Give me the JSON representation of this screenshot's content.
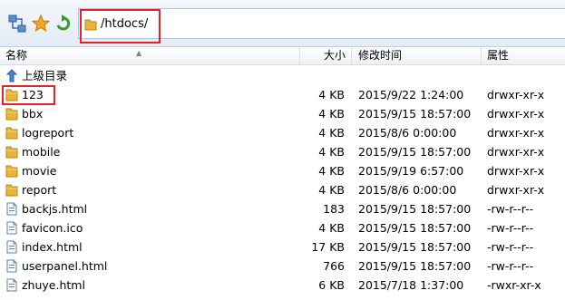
{
  "toolbar": {
    "icons": [
      "connection-icon",
      "favorite-star-icon",
      "refresh-arrow-icon"
    ],
    "path": "/htdocs/"
  },
  "columns": {
    "name": "名称",
    "size": "大小",
    "modified": "修改时间",
    "attrs": "属性"
  },
  "parent_dir": {
    "label": "上级目录"
  },
  "files": [
    {
      "name": "123",
      "size": "4 KB",
      "modified": "2015/9/22 1:24:00",
      "attrs": "drwxr-xr-x",
      "type": "folder"
    },
    {
      "name": "bbx",
      "size": "4 KB",
      "modified": "2015/9/15 18:57:00",
      "attrs": "drwxr-xr-x",
      "type": "folder"
    },
    {
      "name": "logreport",
      "size": "4 KB",
      "modified": "2015/8/6 0:00:00",
      "attrs": "drwxr-xr-x",
      "type": "folder"
    },
    {
      "name": "mobile",
      "size": "4 KB",
      "modified": "2015/9/15 18:57:00",
      "attrs": "drwxr-xr-x",
      "type": "folder"
    },
    {
      "name": "movie",
      "size": "4 KB",
      "modified": "2015/9/19 6:57:00",
      "attrs": "drwxr-xr-x",
      "type": "folder"
    },
    {
      "name": "report",
      "size": "4 KB",
      "modified": "2015/8/6 0:00:00",
      "attrs": "drwxr-xr-x",
      "type": "folder"
    },
    {
      "name": "backjs.html",
      "size": "183",
      "modified": "2015/9/15 18:57:00",
      "attrs": "-rw-r--r--",
      "type": "file"
    },
    {
      "name": "favicon.ico",
      "size": "4 KB",
      "modified": "2015/9/15 18:57:00",
      "attrs": "-rw-r--r--",
      "type": "file"
    },
    {
      "name": "index.html",
      "size": "17 KB",
      "modified": "2015/9/15 18:57:00",
      "attrs": "-rw-r--r--",
      "type": "file"
    },
    {
      "name": "userpanel.html",
      "size": "766",
      "modified": "2015/9/15 18:57:00",
      "attrs": "-rw-r--r--",
      "type": "file"
    },
    {
      "name": "zhuye.html",
      "size": "6 KB",
      "modified": "2015/7/18 1:37:00",
      "attrs": "-rwxr-xr-x",
      "type": "file"
    }
  ],
  "colors": {
    "highlight_box": "#e8202a",
    "folder": "#e8b53a",
    "header_bg": "#eef1f5"
  }
}
